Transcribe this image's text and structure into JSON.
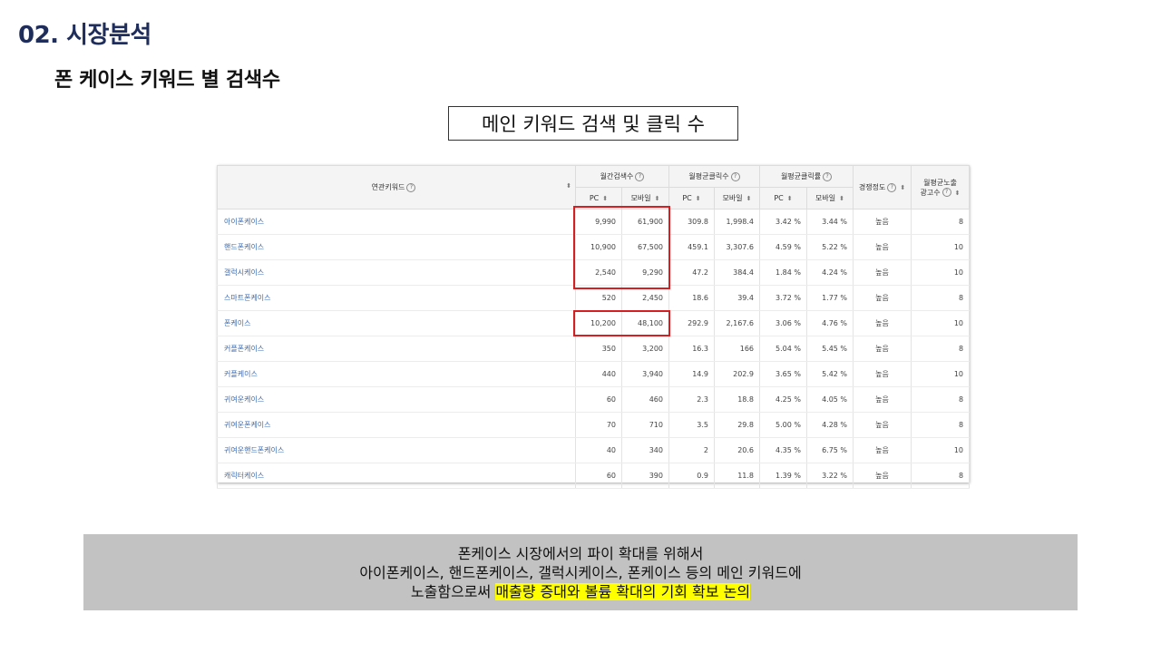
{
  "title": "02. 시장분석",
  "subtitle": "폰 케이스 키워드 별 검색수",
  "boxed_label": "메인 키워드 검색 및 클릭 수",
  "table": {
    "headers": {
      "keyword": "연관키워드",
      "monthly_search": "월간검색수",
      "monthly_avg_clicks": "월평균클릭수",
      "monthly_avg_ctr": "월평균클릭률",
      "competition": "경쟁정도",
      "ad_count_line1": "월평균노출",
      "ad_count_line2": "광고수",
      "pc": "PC",
      "mobile": "모바일"
    },
    "rows": [
      {
        "keyword": "아이폰케이스",
        "pc": "9,990",
        "mobile": "61,900",
        "click_pc": "309.8",
        "click_mobile": "1,998.4",
        "ctr_pc": "3.42 %",
        "ctr_mobile": "3.44 %",
        "competition": "높음",
        "ads": "8"
      },
      {
        "keyword": "핸드폰케이스",
        "pc": "10,900",
        "mobile": "67,500",
        "click_pc": "459.1",
        "click_mobile": "3,307.6",
        "ctr_pc": "4.59 %",
        "ctr_mobile": "5.22 %",
        "competition": "높음",
        "ads": "10"
      },
      {
        "keyword": "갤럭시케이스",
        "pc": "2,540",
        "mobile": "9,290",
        "click_pc": "47.2",
        "click_mobile": "384.4",
        "ctr_pc": "1.84 %",
        "ctr_mobile": "4.24 %",
        "competition": "높음",
        "ads": "10"
      },
      {
        "keyword": "스마트폰케이스",
        "pc": "520",
        "mobile": "2,450",
        "click_pc": "18.6",
        "click_mobile": "39.4",
        "ctr_pc": "3.72 %",
        "ctr_mobile": "1.77 %",
        "competition": "높음",
        "ads": "8"
      },
      {
        "keyword": "폰케이스",
        "pc": "10,200",
        "mobile": "48,100",
        "click_pc": "292.9",
        "click_mobile": "2,167.6",
        "ctr_pc": "3.06 %",
        "ctr_mobile": "4.76 %",
        "competition": "높음",
        "ads": "10"
      },
      {
        "keyword": "커플폰케이스",
        "pc": "350",
        "mobile": "3,200",
        "click_pc": "16.3",
        "click_mobile": "166",
        "ctr_pc": "5.04 %",
        "ctr_mobile": "5.45 %",
        "competition": "높음",
        "ads": "8"
      },
      {
        "keyword": "커플케이스",
        "pc": "440",
        "mobile": "3,940",
        "click_pc": "14.9",
        "click_mobile": "202.9",
        "ctr_pc": "3.65 %",
        "ctr_mobile": "5.42 %",
        "competition": "높음",
        "ads": "10"
      },
      {
        "keyword": "귀여운케이스",
        "pc": "60",
        "mobile": "460",
        "click_pc": "2.3",
        "click_mobile": "18.8",
        "ctr_pc": "4.25 %",
        "ctr_mobile": "4.05 %",
        "competition": "높음",
        "ads": "8"
      },
      {
        "keyword": "귀여운폰케이스",
        "pc": "70",
        "mobile": "710",
        "click_pc": "3.5",
        "click_mobile": "29.8",
        "ctr_pc": "5.00 %",
        "ctr_mobile": "4.28 %",
        "competition": "높음",
        "ads": "8"
      },
      {
        "keyword": "귀여운핸드폰케이스",
        "pc": "40",
        "mobile": "340",
        "click_pc": "2",
        "click_mobile": "20.6",
        "ctr_pc": "4.35 %",
        "ctr_mobile": "6.75 %",
        "competition": "높음",
        "ads": "10"
      },
      {
        "keyword": "캐릭터케이스",
        "pc": "60",
        "mobile": "390",
        "click_pc": "0.9",
        "click_mobile": "11.8",
        "ctr_pc": "1.39 %",
        "ctr_mobile": "3.22 %",
        "competition": "높음",
        "ads": "8"
      }
    ]
  },
  "summary": {
    "line1": "폰케이스 시장에서의 파이 확대를 위해서",
    "line2": "아이폰케이스, 핸드폰케이스, 갤럭시케이스, 폰케이스 등의 메인 키워드에",
    "line3_plain": "노출함으로써 ",
    "line3_highlight": "매출량 증대와 볼륨 확대의 기회 확보 논의"
  },
  "colors": {
    "title": "#1f2d5a",
    "keyword_link": "#3b6bb5",
    "highlight_box": "#d42020",
    "summary_bg": "#c2c2c2",
    "text_highlight": "#ffff00"
  }
}
